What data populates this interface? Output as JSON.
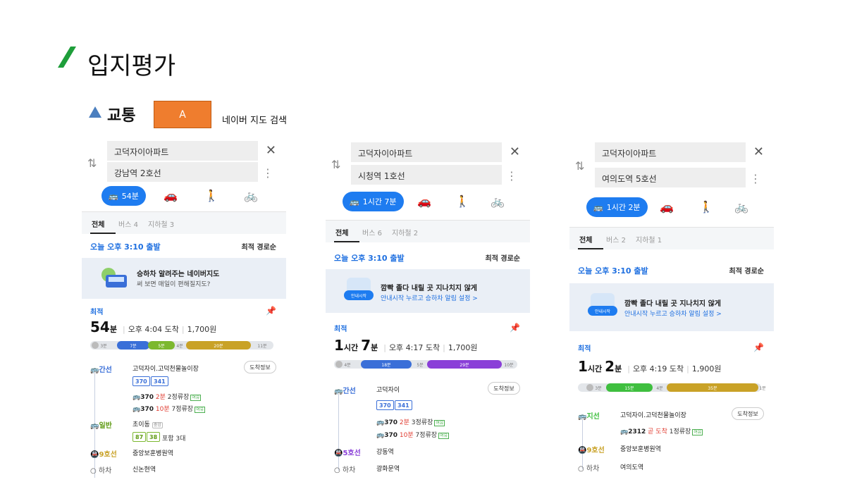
{
  "slide": {
    "title": "입지평가",
    "subtitle": "교통",
    "box_label": "A",
    "box_caption": "네이버 지도 검색"
  },
  "colors": {
    "accent": "#1e7cf0",
    "orange": "#ef7d2e",
    "green_mark": "#1e9e3a"
  },
  "phones": [
    {
      "origin": "고덕자이아파트",
      "destination": "강남역 2호선",
      "mode_active": "54분",
      "tabs": [
        "전체",
        "버스 4",
        "지하철 3"
      ],
      "depart": "오늘 오후 3:10 출발",
      "sort": "최적 경로순",
      "banner_title": "승하차 알려주는 네이버지도",
      "banner_sub": "써 보면 매일이 편해질지도?",
      "best": "최적",
      "time_big": "54",
      "time_unit": "분",
      "arrive": "오후 4:04 도착",
      "fare": "1,700원",
      "bar_labels": [
        "3분",
        "7분",
        "5분",
        "4분",
        "20분",
        "11분"
      ],
      "leg1_label": "간선",
      "leg1_stop": "고덕자이.고덕천물놀이장",
      "arrive_btn": "도착정보",
      "chips": [
        "370",
        "341"
      ],
      "bus_a_no": "370",
      "bus_a_time": "2분",
      "bus_a_rest": "2정류장",
      "bus_a_tag": "여유",
      "bus_b_no": "370",
      "bus_b_time": "10분",
      "bus_b_rest": "7정류장",
      "bus_b_tag": "여유",
      "leg2_label": "일반",
      "leg2_stop": "초이동",
      "leg2_tag": "중앙",
      "chips2": [
        "87",
        "38"
      ],
      "chips2_more": "포함 3대",
      "leg3_label": "9호선",
      "leg3_stop": "중앙보훈병원역",
      "leg4_label": "하차",
      "leg4_stop": "신논현역"
    },
    {
      "origin": "고덕자이아파트",
      "destination": "시청역 1호선",
      "mode_active": "1시간 7분",
      "tabs": [
        "전체",
        "버스 6",
        "지하철 2"
      ],
      "depart": "오늘 오후 3:10 출발",
      "sort": "최적 경로순",
      "banner_badge": "안내시작",
      "banner_title": "깜빡 졸다 내릴 곳 지나치지 않게",
      "banner_sub": "안내시작 누르고 승하차 알림 설정 >",
      "best": "최적",
      "time_big": "1",
      "time_unit": "시간",
      "time_big2": "7",
      "time_unit2": "분",
      "arrive": "오후 4:17 도착",
      "fare": "1,700원",
      "bar_labels": [
        "4분",
        "18분",
        "5분",
        "29분",
        "10분"
      ],
      "leg1_label": "간선",
      "leg1_stop": "고덕자이",
      "arrive_btn": "도착정보",
      "chips": [
        "370",
        "341"
      ],
      "bus_a_no": "370",
      "bus_a_time": "2분",
      "bus_a_rest": "3정류장",
      "bus_a_tag": "여유",
      "bus_b_no": "370",
      "bus_b_time": "10분",
      "bus_b_rest": "7정류장",
      "bus_b_tag": "여유",
      "leg2_label": "5호선",
      "leg2_stop": "강동역",
      "leg3_label": "하차",
      "leg3_stop": "광화문역"
    },
    {
      "origin": "고덕자이아파트",
      "destination": "여의도역 5호선",
      "mode_active": "1시간 2분",
      "tabs": [
        "전체",
        "버스 2",
        "지하철 1"
      ],
      "depart": "오늘 오후 3:10 출발",
      "sort": "최적 경로순",
      "banner_badge": "안내시작",
      "banner_title": "깜빡 졸다 내릴 곳 지나치지 않게",
      "banner_sub": "안내시작 누르고 승하차 알림 설정 >",
      "best": "최적",
      "time_big": "1",
      "time_unit": "시간",
      "time_big2": "2",
      "time_unit2": "분",
      "arrive": "오후 4:19 도착",
      "fare": "1,900원",
      "bar_labels": [
        "3분",
        "15분",
        "4분",
        "35분",
        "1분"
      ],
      "leg1_label": "지선",
      "leg1_stop": "고덕자이.고덕천물놀이장",
      "arrive_btn": "도착정보",
      "bus_a_no": "2312",
      "bus_a_time": "곧 도착",
      "bus_a_rest": "1정류장",
      "bus_a_tag": "여유",
      "leg2_label": "9호선",
      "leg2_stop": "중앙보훈병원역",
      "leg3_label": "하차",
      "leg3_stop": "여의도역"
    }
  ]
}
